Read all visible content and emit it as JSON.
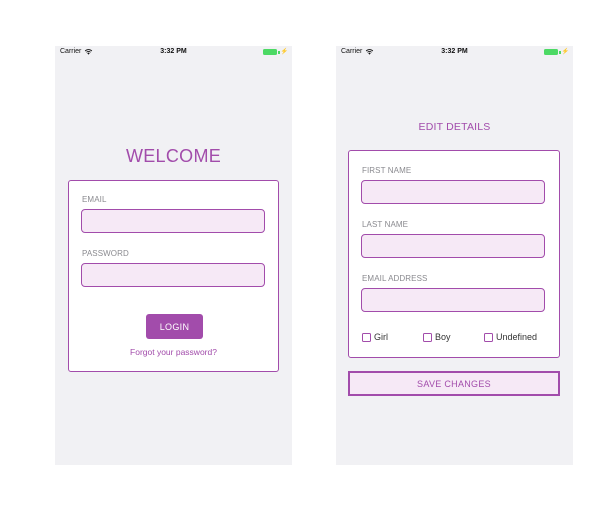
{
  "status_bar": {
    "carrier": "Carrier",
    "time": "3:32 PM",
    "wifi_icon": "wifi-icon",
    "battery_icon": "battery-icon",
    "battery_color": "#4cd964"
  },
  "theme": {
    "accent": "#a24cab",
    "input_fill": "#f6e9f6",
    "screen_background": "#f1f1f4"
  },
  "login_screen": {
    "title": "WELCOME",
    "email_label": "EMAIL",
    "email_value": "",
    "password_label": "PASSWORD",
    "password_value": "",
    "login_button": "LOGIN",
    "forgot_password": "Forgot your password?"
  },
  "edit_screen": {
    "title": "EDIT DETAILS",
    "first_name_label": "FIRST NAME",
    "first_name_value": "",
    "last_name_label": "LAST NAME",
    "last_name_value": "",
    "email_label": "EMAIL ADDRESS",
    "email_value": "",
    "gender_options": [
      {
        "label": "Girl",
        "checked": false
      },
      {
        "label": "Boy",
        "checked": false
      },
      {
        "label": "Undefined",
        "checked": false
      }
    ],
    "save_button": "SAVE CHANGES"
  }
}
